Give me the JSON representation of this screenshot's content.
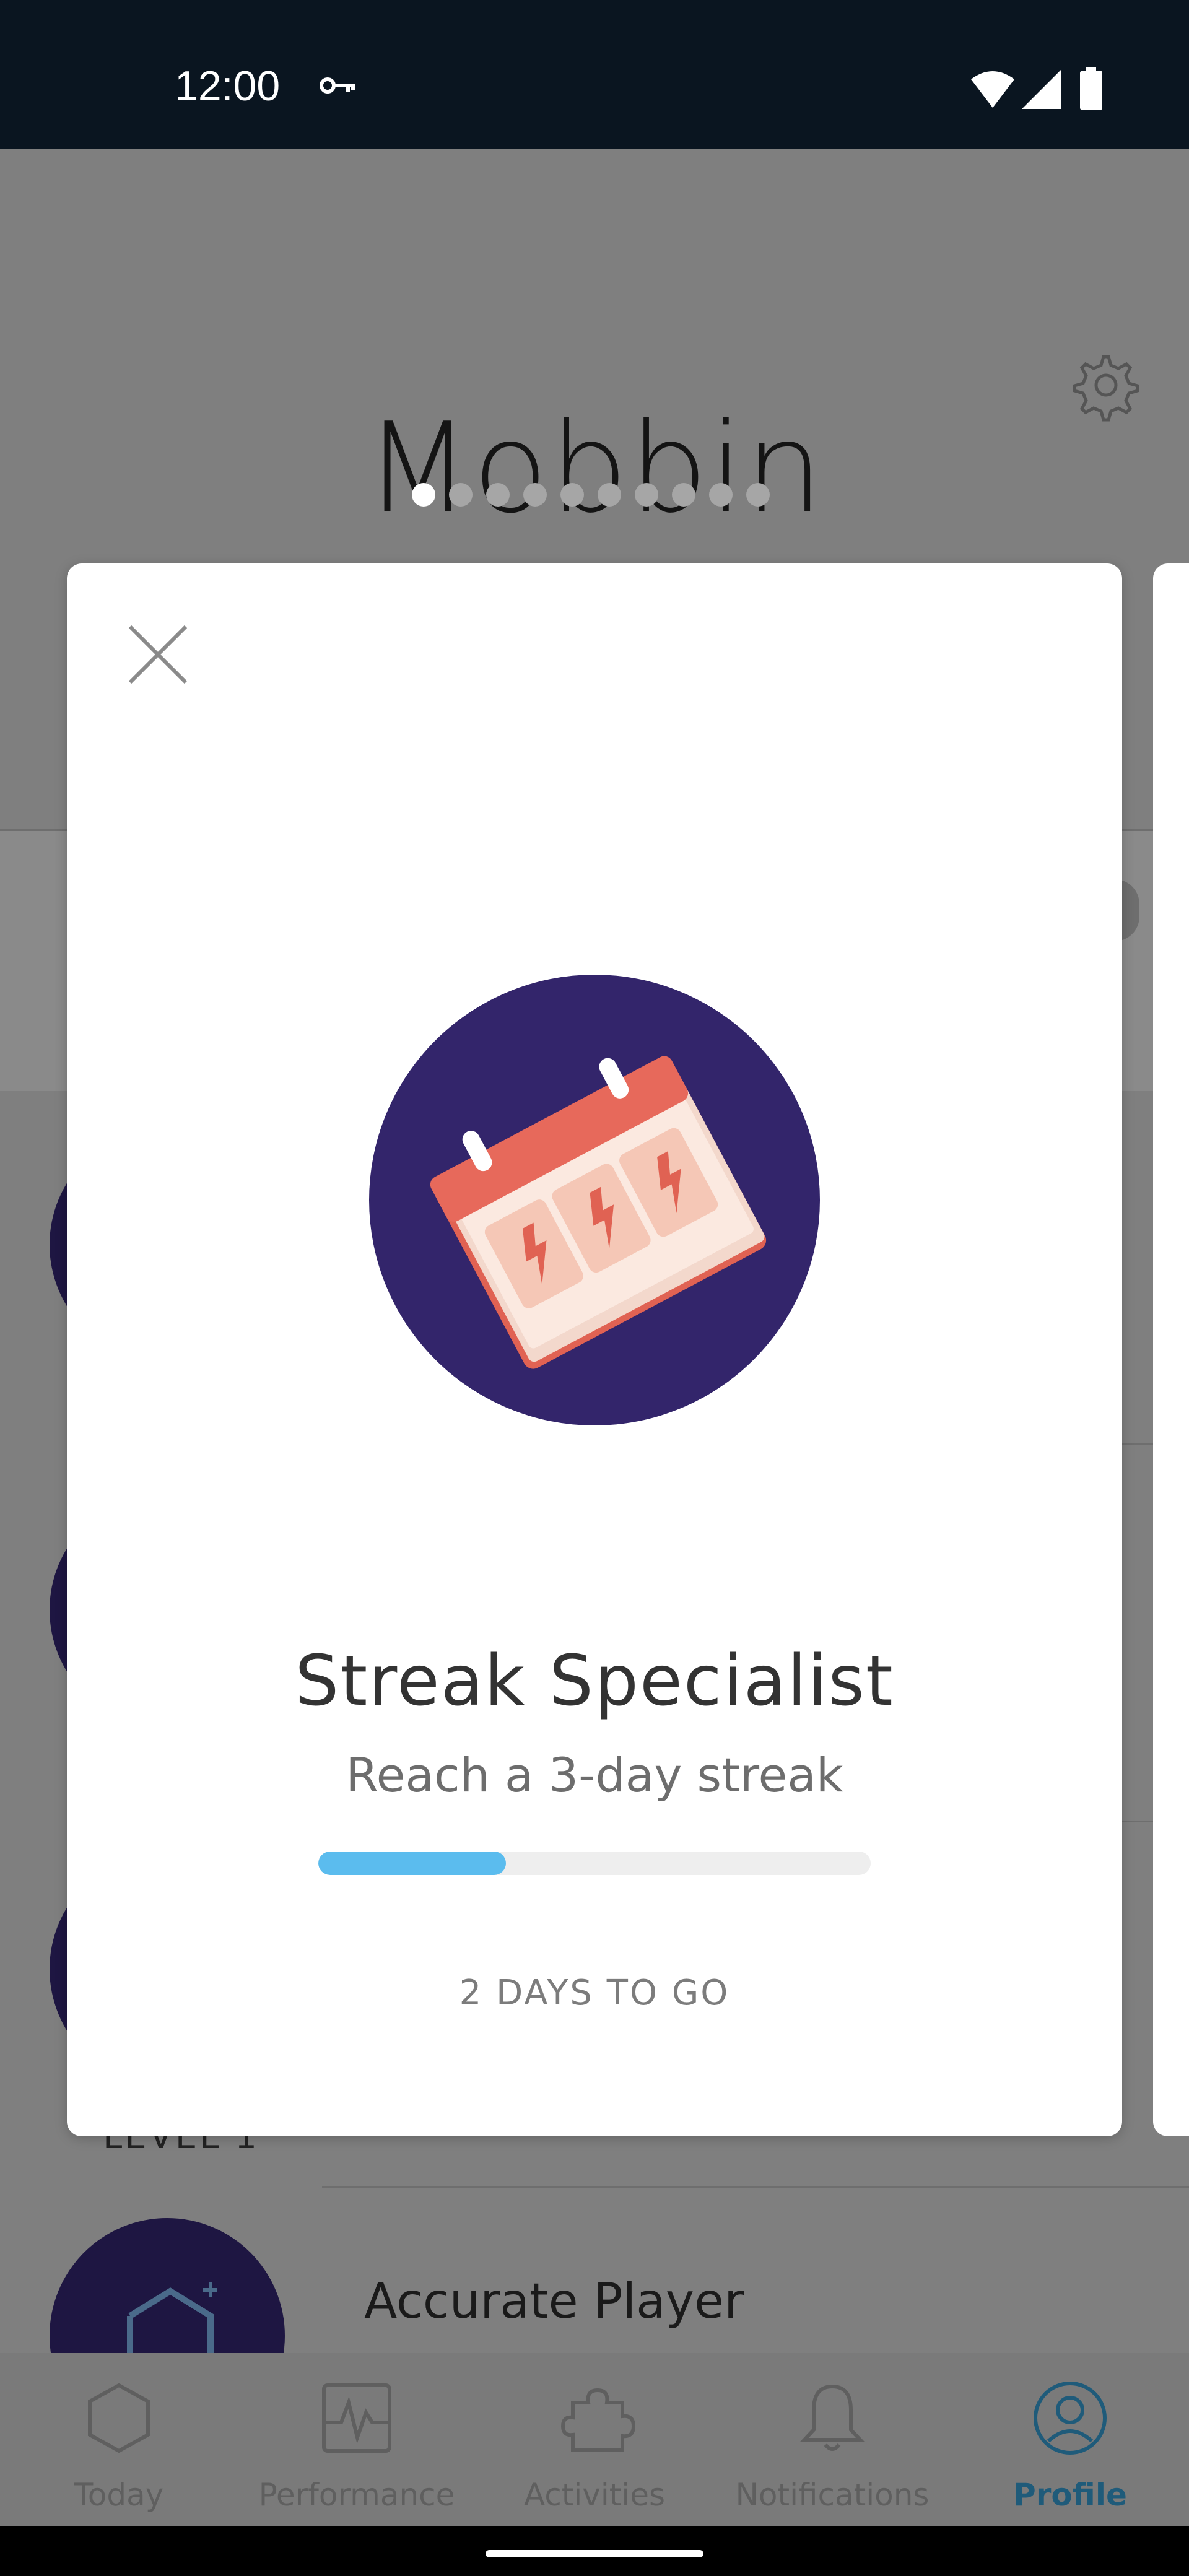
{
  "status_bar": {
    "time": "12:00",
    "icons": [
      "vpn-key-icon",
      "wifi-icon",
      "cell-signal-icon",
      "battery-icon"
    ]
  },
  "background_page": {
    "title": "Mobbin",
    "level_text": "LEVEL 1",
    "row_label": "Accurate Player"
  },
  "pager": {
    "total": 10,
    "active_index": 0
  },
  "modal": {
    "title": "Streak Specialist",
    "subtitle": "Reach a 3-day streak",
    "progress_fraction": 0.34,
    "goal_text": "2 DAYS TO GO",
    "colors": {
      "progress_fill": "#5bbcee",
      "progress_track": "#eeeeee",
      "badge_bg": "#33256b"
    }
  },
  "bottom_nav": {
    "items": [
      {
        "label": "Today",
        "icon": "hexagon-icon"
      },
      {
        "label": "Performance",
        "icon": "pulse-chart-icon"
      },
      {
        "label": "Activities",
        "icon": "puzzle-icon"
      },
      {
        "label": "Notifications",
        "icon": "bell-icon"
      },
      {
        "label": "Profile",
        "icon": "profile-icon"
      }
    ],
    "active": "Profile",
    "colors": {
      "active": "#1f5b7a"
    }
  }
}
